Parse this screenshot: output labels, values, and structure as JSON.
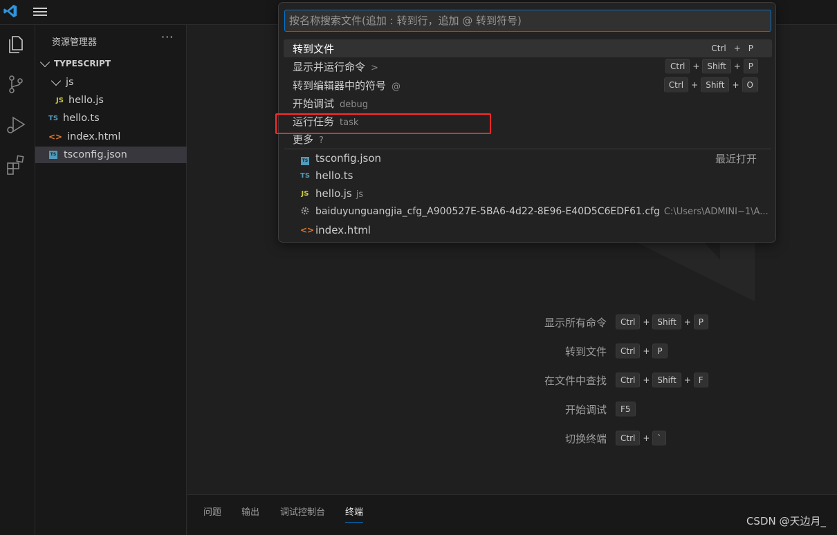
{
  "sidebar": {
    "title": "资源管理器",
    "more": "···",
    "root": "TYPESCRIPT",
    "items": [
      {
        "label": "js",
        "badge": "folder"
      },
      {
        "label": "hello.js",
        "badge": "JS"
      },
      {
        "label": "hello.ts",
        "badge": "TS"
      },
      {
        "label": "index.html",
        "badge": "<>"
      },
      {
        "label": "tsconfig.json",
        "badge": "tsconfig"
      }
    ]
  },
  "quickopen": {
    "placeholder": "按名称搜索文件(追加 : 转到行，追加 @ 转到符号)",
    "commands": [
      {
        "label": "转到文件",
        "desc": "",
        "keys": [
          "Ctrl",
          "P"
        ]
      },
      {
        "label": "显示并运行命令",
        "desc": ">",
        "keys": [
          "Ctrl",
          "Shift",
          "P"
        ]
      },
      {
        "label": "转到编辑器中的符号",
        "desc": "@",
        "keys": [
          "Ctrl",
          "Shift",
          "O"
        ]
      },
      {
        "label": "开始调试",
        "desc": "debug",
        "keys": []
      },
      {
        "label": "运行任务",
        "desc": "task",
        "keys": []
      },
      {
        "label": "更多",
        "desc": "?",
        "keys": []
      }
    ],
    "recent_label": "最近打开",
    "files": [
      {
        "label": "tsconfig.json",
        "desc": "",
        "icon": "tsconfig-icon"
      },
      {
        "label": "hello.ts",
        "desc": "",
        "icon": "ts-icon"
      },
      {
        "label": "hello.js",
        "desc": "js",
        "icon": "js-icon"
      },
      {
        "label": "baiduyunguangjia_cfg_A900527E-5BA6-4d22-8E96-E40D5C6EDF61.cfg",
        "desc": "C:\\Users\\ADMINI~1\\A...",
        "icon": "gear-icon"
      },
      {
        "label": "index.html",
        "desc": "",
        "icon": "html-icon"
      }
    ]
  },
  "shortcuts": [
    {
      "label": "显示所有命令",
      "keys": [
        "Ctrl",
        "Shift",
        "P"
      ]
    },
    {
      "label": "转到文件",
      "keys": [
        "Ctrl",
        "P"
      ]
    },
    {
      "label": "在文件中查找",
      "keys": [
        "Ctrl",
        "Shift",
        "F"
      ]
    },
    {
      "label": "开始调试",
      "keys": [
        "F5"
      ]
    },
    {
      "label": "切换终端",
      "keys": [
        "Ctrl",
        "`"
      ]
    }
  ],
  "panel": {
    "tabs": [
      "问题",
      "输出",
      "调试控制台",
      "终端"
    ],
    "active": "终端"
  },
  "watermark": "CSDN @天边月_",
  "colors": {
    "accent": "#0078d4",
    "highlight": "#ff2a2a"
  }
}
